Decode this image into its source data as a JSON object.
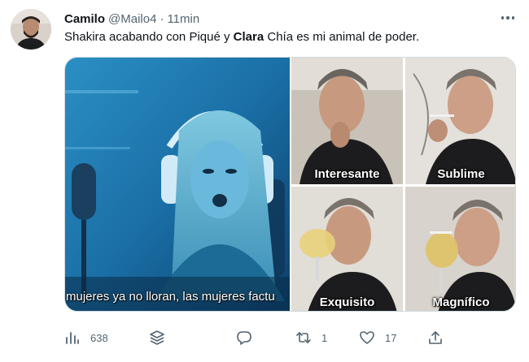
{
  "tweet": {
    "author_name": "Camilo",
    "handle": "@Mailo4",
    "separator": "·",
    "time": "11min",
    "text_before": "Shakira acabando con Piqué y ",
    "text_bold": "Clara",
    "text_after": " Chía es mi animal de poder."
  },
  "media": {
    "video_caption": "mujeres ya no lloran, las mujeres factu",
    "meme_labels": [
      "Interesante",
      "Sublime",
      "Exquisito",
      "Magnífico"
    ]
  },
  "actions": {
    "views_icon": "analytics-icon",
    "views_count": "638",
    "stack_icon": "stack-icon",
    "reply_icon": "reply-icon",
    "retweet_icon": "retweet-icon",
    "retweets_count": "1",
    "like_icon": "heart-icon",
    "likes_count": "17",
    "share_icon": "share-icon"
  },
  "colors": {
    "text_primary": "#0f1419",
    "text_secondary": "#536471",
    "border": "#cfd9de"
  }
}
